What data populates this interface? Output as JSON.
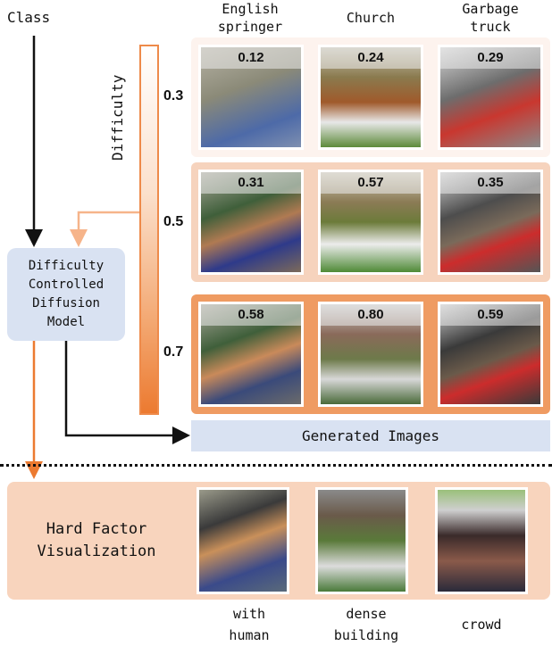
{
  "class_label": "Class",
  "difficulty_label": "Difficulty",
  "columns": [
    "English springer",
    "Church",
    "Garbage truck"
  ],
  "column_lines": [
    [
      "English",
      "springer"
    ],
    [
      "Church"
    ],
    [
      "Garbage",
      "truck"
    ]
  ],
  "levels": [
    {
      "value": "0.3",
      "scores": [
        "0.12",
        "0.24",
        "0.29"
      ]
    },
    {
      "value": "0.5",
      "scores": [
        "0.31",
        "0.57",
        "0.35"
      ]
    },
    {
      "value": "0.7",
      "scores": [
        "0.58",
        "0.80",
        "0.59"
      ]
    }
  ],
  "model_box": [
    "Difficulty",
    "Controlled",
    "Diffusion",
    "Model"
  ],
  "generated_label": "Generated Images",
  "hard_factor": {
    "title_lines": [
      "Hard Factor",
      "Visualization"
    ],
    "factors": [
      [
        "with",
        "human"
      ],
      [
        "dense",
        "building"
      ],
      [
        "crowd"
      ]
    ]
  },
  "colors": {
    "orange_dark": "#ec7a30",
    "orange_light": "#f6b48a",
    "blue_box": "#d9e2f2",
    "peach": "#f8d4bd"
  },
  "image_scenes": [
    "dog-with-human",
    "aerial-church-town",
    "crowd-with-red-truck"
  ]
}
